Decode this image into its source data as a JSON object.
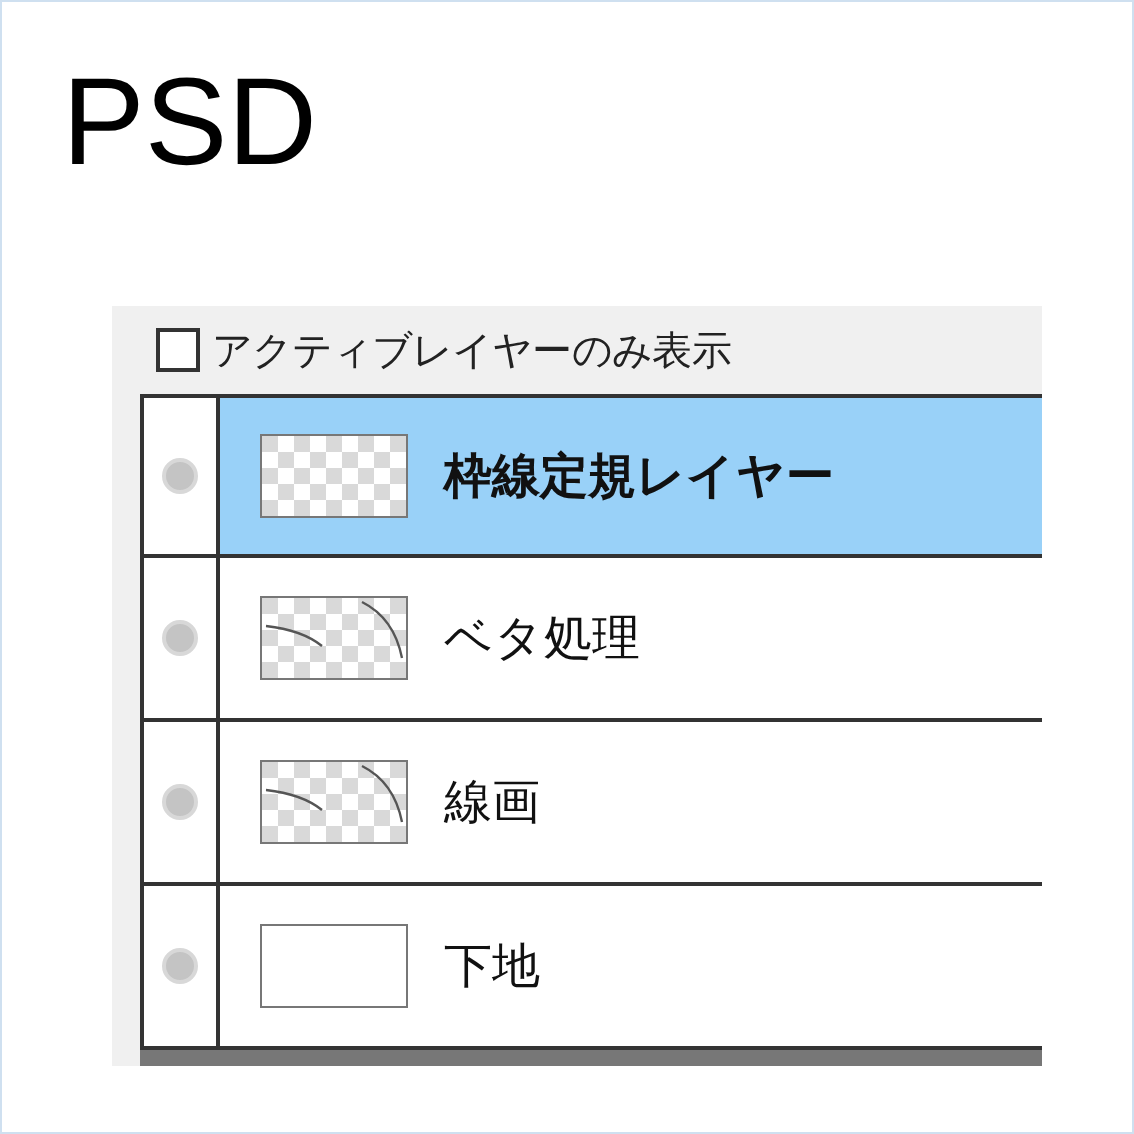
{
  "title": "PSD",
  "active_only": {
    "label": "アクティブレイヤーのみ表示",
    "checked": false
  },
  "layers": [
    {
      "name": "枠線定規レイヤー",
      "selected": true,
      "kind": "transparent"
    },
    {
      "name": "ベタ処理",
      "selected": false,
      "kind": "strokes"
    },
    {
      "name": "線画",
      "selected": false,
      "kind": "strokes"
    },
    {
      "name": "下地",
      "selected": false,
      "kind": "blank"
    }
  ]
}
